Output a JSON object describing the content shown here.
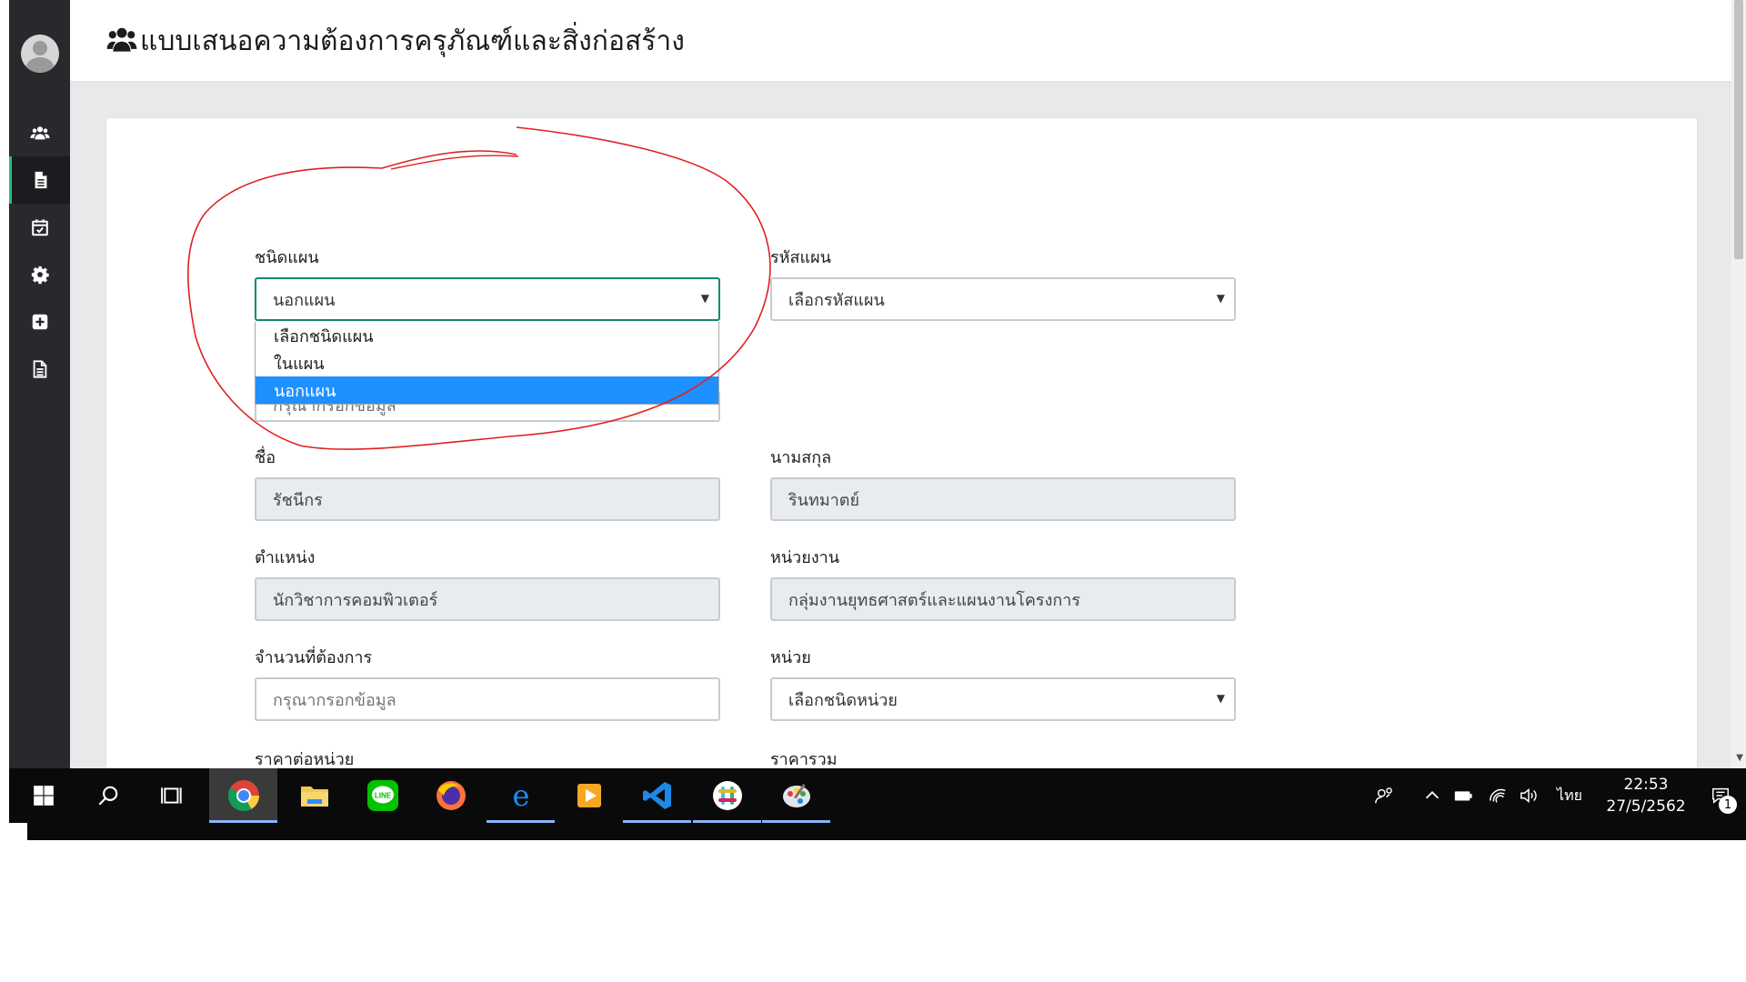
{
  "page": {
    "title": "แบบเสนอความต้องการครุภัณฑ์และสิ่งก่อสร้าง",
    "title_icon": "users-icon"
  },
  "sidebar": {
    "items": [
      {
        "name": "users",
        "icon": "users-icon",
        "active": false
      },
      {
        "name": "document",
        "icon": "file-icon",
        "active": true
      },
      {
        "name": "calendar",
        "icon": "calendar-check-icon",
        "active": false
      },
      {
        "name": "settings",
        "icon": "gear-icon",
        "active": false
      },
      {
        "name": "add",
        "icon": "plus-square-icon",
        "active": false
      },
      {
        "name": "report",
        "icon": "file-text-icon",
        "active": false
      }
    ]
  },
  "form": {
    "plan_type": {
      "label": "ชนิดแผน",
      "value": "นอกแผน",
      "options": [
        "เลือกชนิดแผน",
        "ในแผน",
        "นอกแผน"
      ],
      "selected_index": 2
    },
    "plan_code": {
      "label": "รหัสแผน",
      "value": "เลือกรหัสแผน"
    },
    "hidden_field": {
      "placeholder_visible": "กรุณากรอกข้อมูล"
    },
    "first_name": {
      "label": "ชื่อ",
      "value": "รัชนีกร"
    },
    "last_name": {
      "label": "นามสกุล",
      "value": "รินทมาตย์"
    },
    "position": {
      "label": "ตำแหน่ง",
      "value": "นักวิชาการคอมพิวเตอร์"
    },
    "department": {
      "label": "หน่วยงาน",
      "value": "กลุ่มงานยุทธศาสตร์และแผนงานโครงการ"
    },
    "quantity": {
      "label": "จำนวนที่ต้องการ",
      "placeholder": "กรุณากรอกข้อมูล"
    },
    "unit": {
      "label": "หน่วย",
      "value": "เลือกชนิดหน่วย"
    },
    "unit_price": {
      "label": "ราคาต่อหน่วย"
    },
    "total_price": {
      "label": "ราคารวม"
    }
  },
  "taskbar": {
    "apps": [
      {
        "name": "chrome",
        "icon": "chrome-icon",
        "running": true,
        "active": true
      },
      {
        "name": "file-explorer",
        "icon": "folder-icon",
        "running": false
      },
      {
        "name": "line",
        "icon": "line-icon",
        "running": false
      },
      {
        "name": "firefox",
        "icon": "firefox-icon",
        "running": false
      },
      {
        "name": "edge",
        "icon": "edge-icon",
        "running": true
      },
      {
        "name": "media-player",
        "icon": "media-play-icon",
        "running": false
      },
      {
        "name": "vscode",
        "icon": "vscode-icon",
        "running": true
      },
      {
        "name": "slack",
        "icon": "slack-icon",
        "running": true
      },
      {
        "name": "paint",
        "icon": "palette-icon",
        "running": true
      }
    ],
    "language": "ไทย",
    "time": "22:53",
    "date": "27/5/2562",
    "notification_count": "1"
  },
  "colors": {
    "sidebar_bg": "#27292d",
    "sidebar_active_accent": "#1fbf8f",
    "select_focus_border": "#0f8a6e",
    "dropdown_selected": "#1e90ff",
    "annotation": "#e02020"
  }
}
